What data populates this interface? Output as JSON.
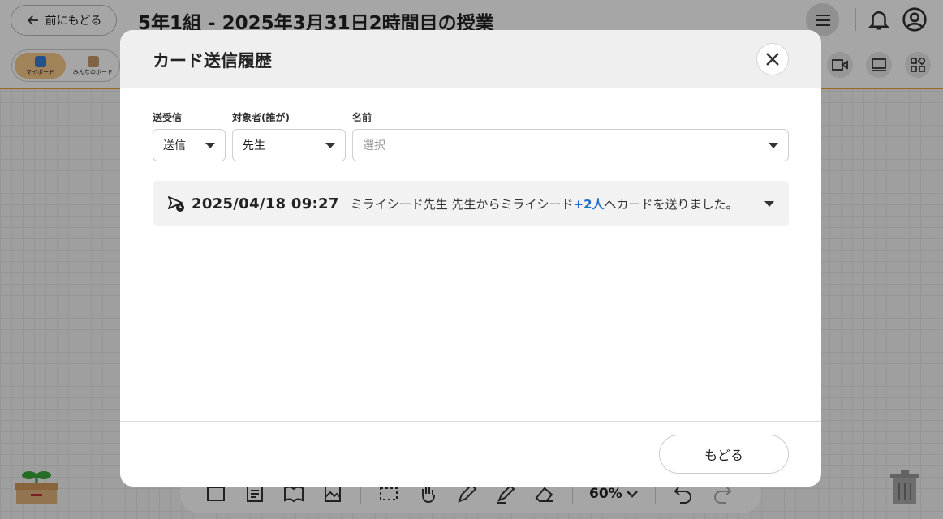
{
  "app": {
    "back_label": "前にもどる",
    "page_title": "5年1組 - 2025年3月31日2時間目の授業",
    "board_tabs": [
      "マイボード",
      "みんなのボード"
    ],
    "zoom": "60%"
  },
  "modal": {
    "title": "カード送信履歴",
    "filters": {
      "direction": {
        "label": "送受信",
        "value": "送信"
      },
      "target": {
        "label": "対象者(誰が)",
        "value": "先生"
      },
      "name": {
        "label": "名前",
        "placeholder": "選択"
      }
    },
    "history": [
      {
        "timestamp": "2025/04/18  09:27",
        "message_prefix": "ミライシード先生 先生からミライシード",
        "count": "+2人",
        "message_suffix": "へカードを送りました。"
      }
    ],
    "footer_button": "もどる"
  },
  "colors": {
    "accent": "#f0a030",
    "link": "#1d6fc8"
  }
}
